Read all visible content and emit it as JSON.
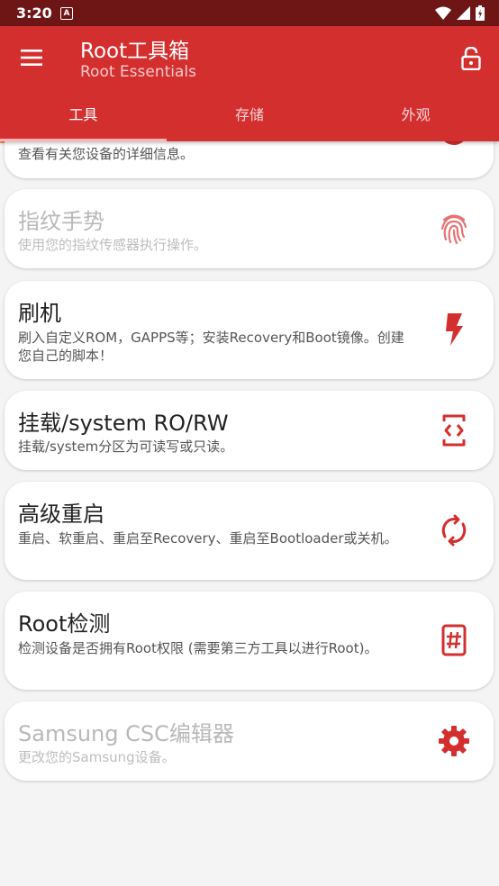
{
  "status": {
    "time": "3:20",
    "notification_letter": "A"
  },
  "app": {
    "title": "Root工具箱",
    "subtitle": "Root Essentials"
  },
  "tabs": [
    {
      "label": "工具",
      "active": true
    },
    {
      "label": "存储",
      "active": false
    },
    {
      "label": "外观",
      "active": false
    }
  ],
  "cards": [
    {
      "title": "",
      "desc": "查看有关您设备的详细信息。",
      "icon": "info-icon",
      "enabled": true
    },
    {
      "title": "指纹手势",
      "desc": "使用您的指纹传感器执行操作。",
      "icon": "fingerprint-icon",
      "enabled": false
    },
    {
      "title": "刷机",
      "desc": "刷入自定义ROM，GAPPS等；安装Recovery和Boot镜像。创建您自己的脚本！",
      "icon": "flash-icon",
      "enabled": true
    },
    {
      "title": "挂载/system RO/RW",
      "desc": "挂载/system分区为可读写或只读。",
      "icon": "mount-icon",
      "enabled": true
    },
    {
      "title": "高级重启",
      "desc": "重启、软重启、重启至Recovery、重启至Bootloader或关机。",
      "icon": "reboot-icon",
      "enabled": true
    },
    {
      "title": "Root检测",
      "desc": "检测设备是否拥有Root权限 (需要第三方工具以进行Root)。",
      "icon": "root-check-icon",
      "enabled": true
    },
    {
      "title": "Samsung CSC编辑器",
      "desc": "更改您的Samsung设备。",
      "icon": "gear-icon",
      "enabled": false
    }
  ],
  "colors": {
    "primary": "#d32f2f",
    "status_bar": "#6e1616",
    "accent": "#ff8a65"
  }
}
